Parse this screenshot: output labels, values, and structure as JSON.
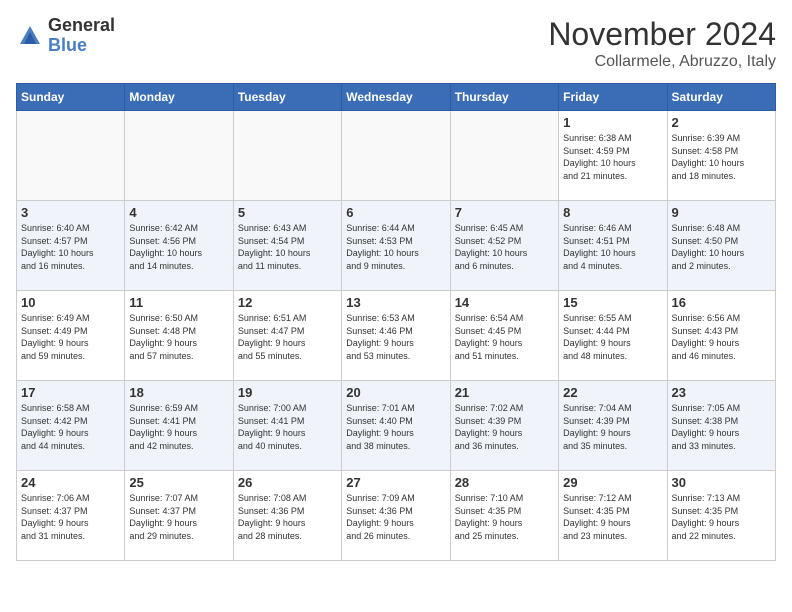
{
  "logo": {
    "line1": "General",
    "line2": "Blue"
  },
  "title": "November 2024",
  "subtitle": "Collarmele, Abruzzo, Italy",
  "days_of_week": [
    "Sunday",
    "Monday",
    "Tuesday",
    "Wednesday",
    "Thursday",
    "Friday",
    "Saturday"
  ],
  "weeks": [
    [
      {
        "day": "",
        "info": ""
      },
      {
        "day": "",
        "info": ""
      },
      {
        "day": "",
        "info": ""
      },
      {
        "day": "",
        "info": ""
      },
      {
        "day": "",
        "info": ""
      },
      {
        "day": "1",
        "info": "Sunrise: 6:38 AM\nSunset: 4:59 PM\nDaylight: 10 hours\nand 21 minutes."
      },
      {
        "day": "2",
        "info": "Sunrise: 6:39 AM\nSunset: 4:58 PM\nDaylight: 10 hours\nand 18 minutes."
      }
    ],
    [
      {
        "day": "3",
        "info": "Sunrise: 6:40 AM\nSunset: 4:57 PM\nDaylight: 10 hours\nand 16 minutes."
      },
      {
        "day": "4",
        "info": "Sunrise: 6:42 AM\nSunset: 4:56 PM\nDaylight: 10 hours\nand 14 minutes."
      },
      {
        "day": "5",
        "info": "Sunrise: 6:43 AM\nSunset: 4:54 PM\nDaylight: 10 hours\nand 11 minutes."
      },
      {
        "day": "6",
        "info": "Sunrise: 6:44 AM\nSunset: 4:53 PM\nDaylight: 10 hours\nand 9 minutes."
      },
      {
        "day": "7",
        "info": "Sunrise: 6:45 AM\nSunset: 4:52 PM\nDaylight: 10 hours\nand 6 minutes."
      },
      {
        "day": "8",
        "info": "Sunrise: 6:46 AM\nSunset: 4:51 PM\nDaylight: 10 hours\nand 4 minutes."
      },
      {
        "day": "9",
        "info": "Sunrise: 6:48 AM\nSunset: 4:50 PM\nDaylight: 10 hours\nand 2 minutes."
      }
    ],
    [
      {
        "day": "10",
        "info": "Sunrise: 6:49 AM\nSunset: 4:49 PM\nDaylight: 9 hours\nand 59 minutes."
      },
      {
        "day": "11",
        "info": "Sunrise: 6:50 AM\nSunset: 4:48 PM\nDaylight: 9 hours\nand 57 minutes."
      },
      {
        "day": "12",
        "info": "Sunrise: 6:51 AM\nSunset: 4:47 PM\nDaylight: 9 hours\nand 55 minutes."
      },
      {
        "day": "13",
        "info": "Sunrise: 6:53 AM\nSunset: 4:46 PM\nDaylight: 9 hours\nand 53 minutes."
      },
      {
        "day": "14",
        "info": "Sunrise: 6:54 AM\nSunset: 4:45 PM\nDaylight: 9 hours\nand 51 minutes."
      },
      {
        "day": "15",
        "info": "Sunrise: 6:55 AM\nSunset: 4:44 PM\nDaylight: 9 hours\nand 48 minutes."
      },
      {
        "day": "16",
        "info": "Sunrise: 6:56 AM\nSunset: 4:43 PM\nDaylight: 9 hours\nand 46 minutes."
      }
    ],
    [
      {
        "day": "17",
        "info": "Sunrise: 6:58 AM\nSunset: 4:42 PM\nDaylight: 9 hours\nand 44 minutes."
      },
      {
        "day": "18",
        "info": "Sunrise: 6:59 AM\nSunset: 4:41 PM\nDaylight: 9 hours\nand 42 minutes."
      },
      {
        "day": "19",
        "info": "Sunrise: 7:00 AM\nSunset: 4:41 PM\nDaylight: 9 hours\nand 40 minutes."
      },
      {
        "day": "20",
        "info": "Sunrise: 7:01 AM\nSunset: 4:40 PM\nDaylight: 9 hours\nand 38 minutes."
      },
      {
        "day": "21",
        "info": "Sunrise: 7:02 AM\nSunset: 4:39 PM\nDaylight: 9 hours\nand 36 minutes."
      },
      {
        "day": "22",
        "info": "Sunrise: 7:04 AM\nSunset: 4:39 PM\nDaylight: 9 hours\nand 35 minutes."
      },
      {
        "day": "23",
        "info": "Sunrise: 7:05 AM\nSunset: 4:38 PM\nDaylight: 9 hours\nand 33 minutes."
      }
    ],
    [
      {
        "day": "24",
        "info": "Sunrise: 7:06 AM\nSunset: 4:37 PM\nDaylight: 9 hours\nand 31 minutes."
      },
      {
        "day": "25",
        "info": "Sunrise: 7:07 AM\nSunset: 4:37 PM\nDaylight: 9 hours\nand 29 minutes."
      },
      {
        "day": "26",
        "info": "Sunrise: 7:08 AM\nSunset: 4:36 PM\nDaylight: 9 hours\nand 28 minutes."
      },
      {
        "day": "27",
        "info": "Sunrise: 7:09 AM\nSunset: 4:36 PM\nDaylight: 9 hours\nand 26 minutes."
      },
      {
        "day": "28",
        "info": "Sunrise: 7:10 AM\nSunset: 4:35 PM\nDaylight: 9 hours\nand 25 minutes."
      },
      {
        "day": "29",
        "info": "Sunrise: 7:12 AM\nSunset: 4:35 PM\nDaylight: 9 hours\nand 23 minutes."
      },
      {
        "day": "30",
        "info": "Sunrise: 7:13 AM\nSunset: 4:35 PM\nDaylight: 9 hours\nand 22 minutes."
      }
    ]
  ]
}
